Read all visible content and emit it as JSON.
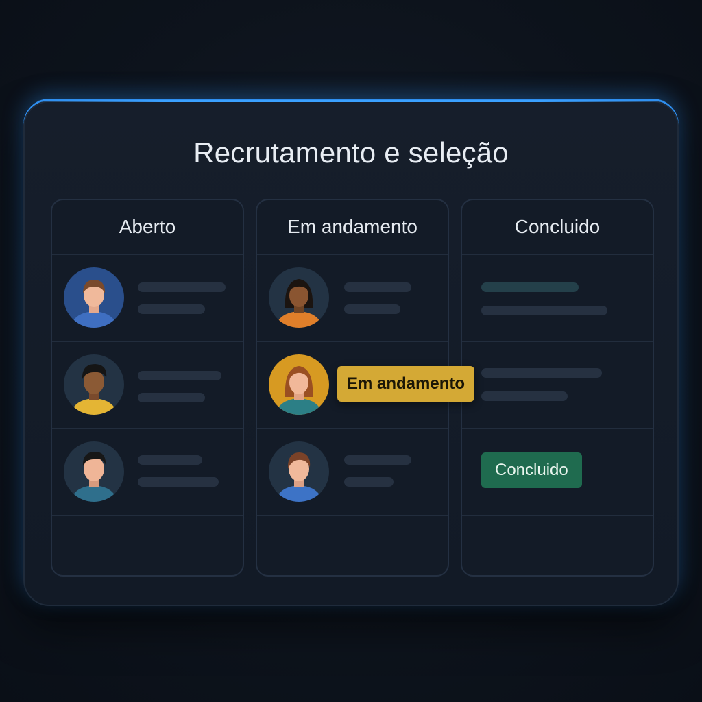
{
  "title": "Recrutamento e seleção",
  "columns": [
    {
      "label": "Aberto"
    },
    {
      "label": "Em andamento"
    },
    {
      "label": "Concluido"
    }
  ],
  "tags": {
    "in_progress": "Em andamento",
    "done": "Concluido"
  },
  "colors": {
    "accent_glow": "#3aa0ff",
    "in_progress_tag": "#d4a935",
    "done_tag": "#1f6b4f",
    "background": "#0d131c"
  }
}
